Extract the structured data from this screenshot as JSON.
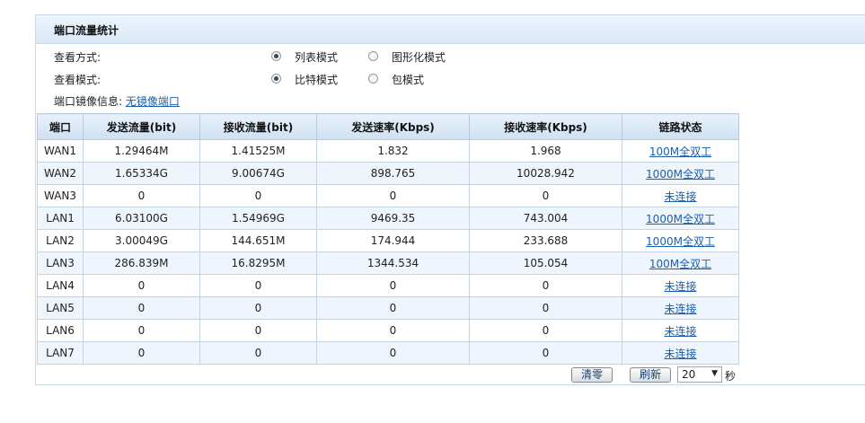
{
  "panel": {
    "title": "端口流量统计"
  },
  "view_mode": {
    "label": "查看方式:",
    "options": [
      {
        "label": "列表模式",
        "checked": true
      },
      {
        "label": "图形化模式",
        "checked": false
      }
    ]
  },
  "data_mode": {
    "label": "查看模式:",
    "options": [
      {
        "label": "比特模式",
        "checked": true
      },
      {
        "label": "包模式",
        "checked": false
      }
    ]
  },
  "mirror": {
    "label": "端口镜像信息:",
    "value": "无镜像端口"
  },
  "table": {
    "headers": [
      "端口",
      "发送流量(bit)",
      "接收流量(bit)",
      "发送速率(Kbps)",
      "接收速率(Kbps)",
      "链路状态"
    ],
    "rows": [
      [
        "WAN1",
        "1.29464M",
        "1.41525M",
        "1.832",
        "1.968",
        "100M全双工"
      ],
      [
        "WAN2",
        "1.65334G",
        "9.00674G",
        "898.765",
        "10028.942",
        "1000M全双工"
      ],
      [
        "WAN3",
        "0",
        "0",
        "0",
        "0",
        "未连接"
      ],
      [
        "LAN1",
        "6.03100G",
        "1.54969G",
        "9469.35",
        "743.004",
        "1000M全双工"
      ],
      [
        "LAN2",
        "3.00049G",
        "144.651M",
        "174.944",
        "233.688",
        "1000M全双工"
      ],
      [
        "LAN3",
        "286.839M",
        "16.8295M",
        "1344.534",
        "105.054",
        "100M全双工"
      ],
      [
        "LAN4",
        "0",
        "0",
        "0",
        "0",
        "未连接"
      ],
      [
        "LAN5",
        "0",
        "0",
        "0",
        "0",
        "未连接"
      ],
      [
        "LAN6",
        "0",
        "0",
        "0",
        "0",
        "未连接"
      ],
      [
        "LAN7",
        "0",
        "0",
        "0",
        "0",
        "未连接"
      ]
    ]
  },
  "controls": {
    "clear_label": "清零",
    "refresh_label": "刷新",
    "interval_value": "20",
    "interval_unit": "秒"
  }
}
